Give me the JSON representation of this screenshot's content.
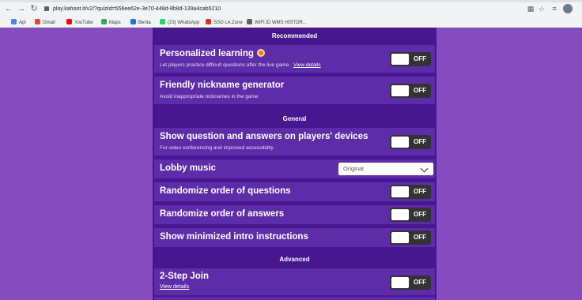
{
  "browser": {
    "url": "play.kahoot.it/v2/?quizId=556ee62e-3e70-448d-8b8d-139a4cab5210",
    "bookmarks": [
      {
        "label": "Apl",
        "color": "#4285f4"
      },
      {
        "label": "Gmail",
        "color": "#ea4335"
      },
      {
        "label": "YouTube",
        "color": "#ff0000"
      },
      {
        "label": "Maps",
        "color": "#34a853"
      },
      {
        "label": "Berita",
        "color": "#1a73e8"
      },
      {
        "label": "(23) WhatsApp",
        "color": "#25d366"
      },
      {
        "label": "SSO LA Zone",
        "color": "#d93025"
      },
      {
        "label": "WIFI.ID WMS HISTOR...",
        "color": "#5f6368"
      }
    ]
  },
  "sections": {
    "recommended": "Recommended",
    "general": "General",
    "advanced": "Advanced"
  },
  "settings": {
    "personalized": {
      "title": "Personalized learning",
      "desc": "Let players practice difficult questions after the live game.",
      "link": "View details",
      "state": "OFF"
    },
    "nickname": {
      "title": "Friendly nickname generator",
      "desc": "Avoid inappropriate nicknames in the game",
      "state": "OFF"
    },
    "show_questions": {
      "title": "Show question and answers on players' devices",
      "desc": "For video conferencing and improved accessibility",
      "state": "OFF"
    },
    "lobby_music": {
      "title": "Lobby music",
      "value": "Original"
    },
    "rand_questions": {
      "title": "Randomize order of questions",
      "state": "OFF"
    },
    "rand_answers": {
      "title": "Randomize order of answers",
      "state": "OFF"
    },
    "intro": {
      "title": "Show minimized intro instructions",
      "state": "OFF"
    },
    "two_step": {
      "title": "2-Step Join",
      "link": "View details",
      "state": "OFF"
    }
  },
  "colors": {
    "page_bg": "#864cbf",
    "panel_bg": "#46178f",
    "row_bg": "#5d2ca8",
    "toggle_bg": "#333333"
  }
}
